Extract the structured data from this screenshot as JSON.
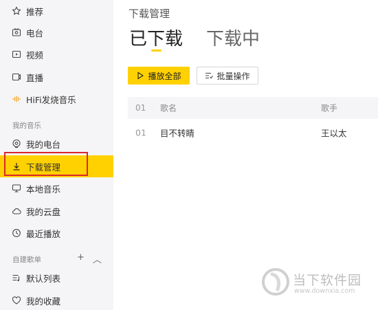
{
  "sidebar": {
    "top_items": [
      {
        "label": "推荐",
        "icon": "star-icon"
      },
      {
        "label": "电台",
        "icon": "radio-icon"
      },
      {
        "label": "视频",
        "icon": "video-icon"
      },
      {
        "label": "直播",
        "icon": "live-icon"
      },
      {
        "label": "HiFi发烧音乐",
        "icon": "hifi-wave-icon"
      }
    ],
    "my_music_label": "我的音乐",
    "my_music_items": [
      {
        "label": "我的电台",
        "icon": "my-radio-icon"
      },
      {
        "label": "下载管理",
        "icon": "download-icon",
        "active": true
      },
      {
        "label": "本地音乐",
        "icon": "monitor-icon"
      },
      {
        "label": "我的云盘",
        "icon": "cloud-icon"
      },
      {
        "label": "最近播放",
        "icon": "clock-icon"
      }
    ],
    "playlists_label": "自建歌单",
    "playlists_add": "+",
    "playlists_collapse": "︿",
    "playlist_items": [
      {
        "label": "默认列表",
        "icon": "playlist-icon"
      },
      {
        "label": "我的收藏",
        "icon": "heart-icon"
      }
    ]
  },
  "main": {
    "page_title": "下载管理",
    "tabs": [
      {
        "label": "已下载",
        "active": true
      },
      {
        "label": "下载中",
        "active": false
      }
    ],
    "play_all_label": "播放全部",
    "batch_label": "批量操作",
    "table": {
      "headers": {
        "index": "01",
        "song": "歌名",
        "artist": "歌手"
      },
      "rows": [
        {
          "index": "01",
          "song": "目不转睛",
          "artist": "王以太"
        }
      ]
    }
  },
  "watermark": {
    "text": "当下软件园",
    "url": "www.downxia.com"
  },
  "colors": {
    "accent": "#ffd100",
    "highlight_box": "#d9262c",
    "sidebar_bg": "#f5f5f7"
  }
}
